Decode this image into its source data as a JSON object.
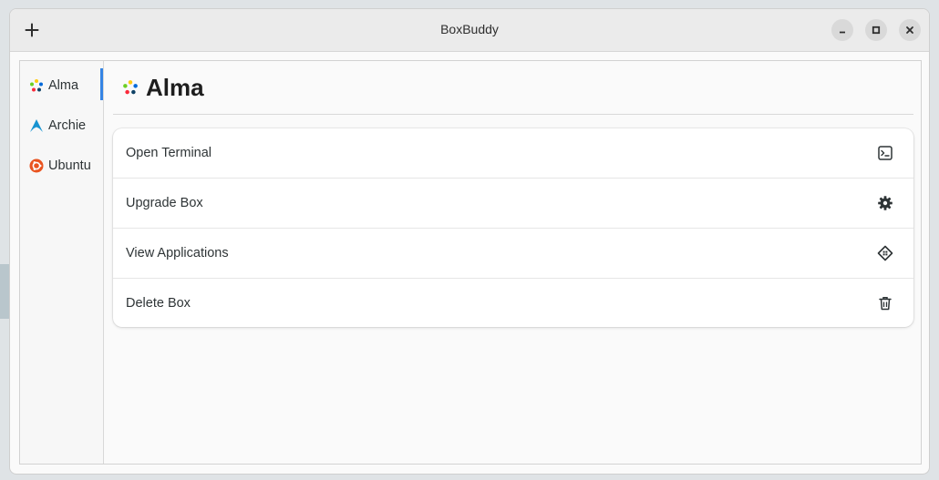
{
  "window": {
    "title": "BoxBuddy",
    "add_icon": "plus-icon",
    "controls": [
      "minimize-icon",
      "maximize-icon",
      "close-icon"
    ]
  },
  "sidebar": {
    "items": [
      {
        "label": "Alma",
        "icon": "alma-logo-icon",
        "active": true
      },
      {
        "label": "Archie",
        "icon": "arch-logo-icon",
        "active": false
      },
      {
        "label": "Ubuntu",
        "icon": "ubuntu-logo-icon",
        "active": false
      }
    ]
  },
  "main": {
    "title": "Alma",
    "title_icon": "alma-logo-icon",
    "actions": [
      {
        "label": "Open Terminal",
        "icon": "terminal-icon"
      },
      {
        "label": "Upgrade Box",
        "icon": "gear-icon"
      },
      {
        "label": "View Applications",
        "icon": "applications-icon"
      },
      {
        "label": "Delete Box",
        "icon": "trash-icon"
      }
    ]
  },
  "colors": {
    "accent": "#3584e4",
    "arch_blue": "#1793d1",
    "ubuntu_orange": "#e95420"
  }
}
